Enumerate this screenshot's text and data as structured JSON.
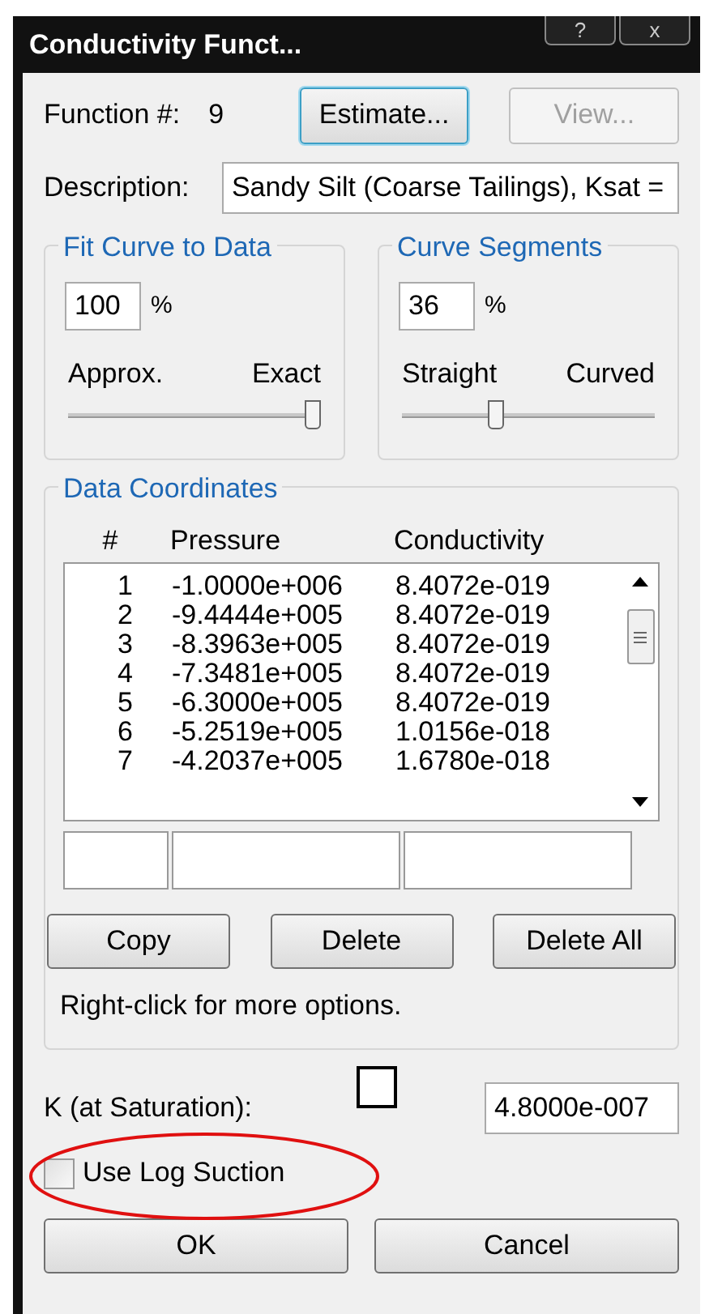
{
  "window": {
    "title": "Conductivity Funct...",
    "buttons": [
      "?",
      "x"
    ]
  },
  "function_number": {
    "label": "Function #:",
    "value": "9"
  },
  "buttons_top": [
    {
      "label": "Estimate...",
      "disabled": false,
      "focused": true
    },
    {
      "label": "View...",
      "disabled": true,
      "focused": false
    }
  ],
  "description": {
    "label": "Description:",
    "value": "Sandy Silt (Coarse Tailings), Ksat ="
  },
  "fit_curve": {
    "title": "Fit Curve to Data",
    "value": "100",
    "unit": "%",
    "min_label": "Approx.",
    "max_label": "Exact",
    "level": 1
  },
  "curve_segments": {
    "title": "Curve Segments",
    "value": "36",
    "unit": "%",
    "min_label": "Straight",
    "max_label": "Curved",
    "level": 0.36
  },
  "data_coordinates": {
    "title": "Data Coordinates",
    "columns": [
      "#",
      "Pressure",
      "Conductivity"
    ],
    "rows": [
      [
        "1",
        "-1.0000e+006",
        "8.4072e-019"
      ],
      [
        "2",
        "-9.4444e+005",
        "8.4072e-019"
      ],
      [
        "3",
        "-8.3963e+005",
        "8.4072e-019"
      ],
      [
        "4",
        "-7.3481e+005",
        "8.4072e-019"
      ],
      [
        "5",
        "-6.3000e+005",
        "8.4072e-019"
      ],
      [
        "6",
        "-5.2519e+005",
        "1.0156e-018"
      ],
      [
        "7",
        "-4.2037e+005",
        "1.6780e-018"
      ]
    ],
    "buttons": [
      "Copy",
      "Delete",
      "Delete All"
    ],
    "hint": "Right-click for more options."
  },
  "k_saturation": {
    "label": "K (at Saturation):",
    "value": "4.8000e-007"
  },
  "use_log_suction": {
    "label": "Use Log Suction",
    "checked": false
  },
  "footer_buttons": [
    "OK",
    "Cancel"
  ]
}
